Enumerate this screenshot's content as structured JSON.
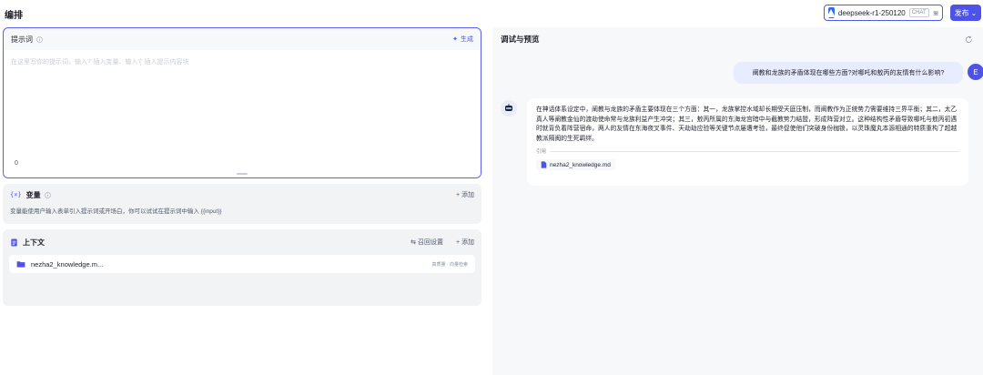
{
  "header": {
    "title": "编排",
    "model": {
      "name": "deepseek-r1-250120",
      "badge": "CHAT"
    },
    "publish_label": "发布"
  },
  "prompt": {
    "title": "提示词",
    "generate_label": "生成",
    "placeholder": "在这里写你的提示词，输入'/' 插入变量、输入'{' 插入提示内容块",
    "count": "0"
  },
  "variables": {
    "title": "变量",
    "add_label": "+ 添加",
    "description": "变量能使用户输入表单引入提示词或开场白，你可以试试在提示词中输入 {{input}}"
  },
  "context": {
    "title": "上下文",
    "recall_label": "召回设置",
    "add_label": "+ 添加",
    "items": [
      {
        "name": "nezha2_knowledge.m...",
        "tag": "高质量 · 向量检索"
      }
    ]
  },
  "debug": {
    "title": "调试与预览",
    "user_initial": "E",
    "user_message": "阐教和龙族的矛盾体现在哪些方面?对哪吒和敖丙的友情有什么影响?",
    "bot_message": "在神话体系设定中，阐教与龙族的矛盾主要体现在三个方面：其一，龙族掌控水域却长期受天庭压制，而阐教作为正统势力需要维持三界平衡；其二，太乙真人等阐教金仙的渡劫使命常与龙族利益产生冲突；其三，敖丙所属的东海龙宫暗中与截教势力结盟，形成阵营对立。这种结构性矛盾导致哪吒与敖丙初遇时就背负着阵营宿命，两人的友情在东海夜叉事件、天劫劫应验等关键节点屡遭考验，最终促使他们突破身份枷锁，以灵珠魔丸本源相通的特质重构了超越教派隔阂的生死羁绊。",
    "cite_label": "引用",
    "cite_file": "nezha2_knowledge.md"
  },
  "colors": {
    "accent": "#4d53e8",
    "prompt_border": "#5b5ff0",
    "user_bubble": "#e8ecff"
  }
}
